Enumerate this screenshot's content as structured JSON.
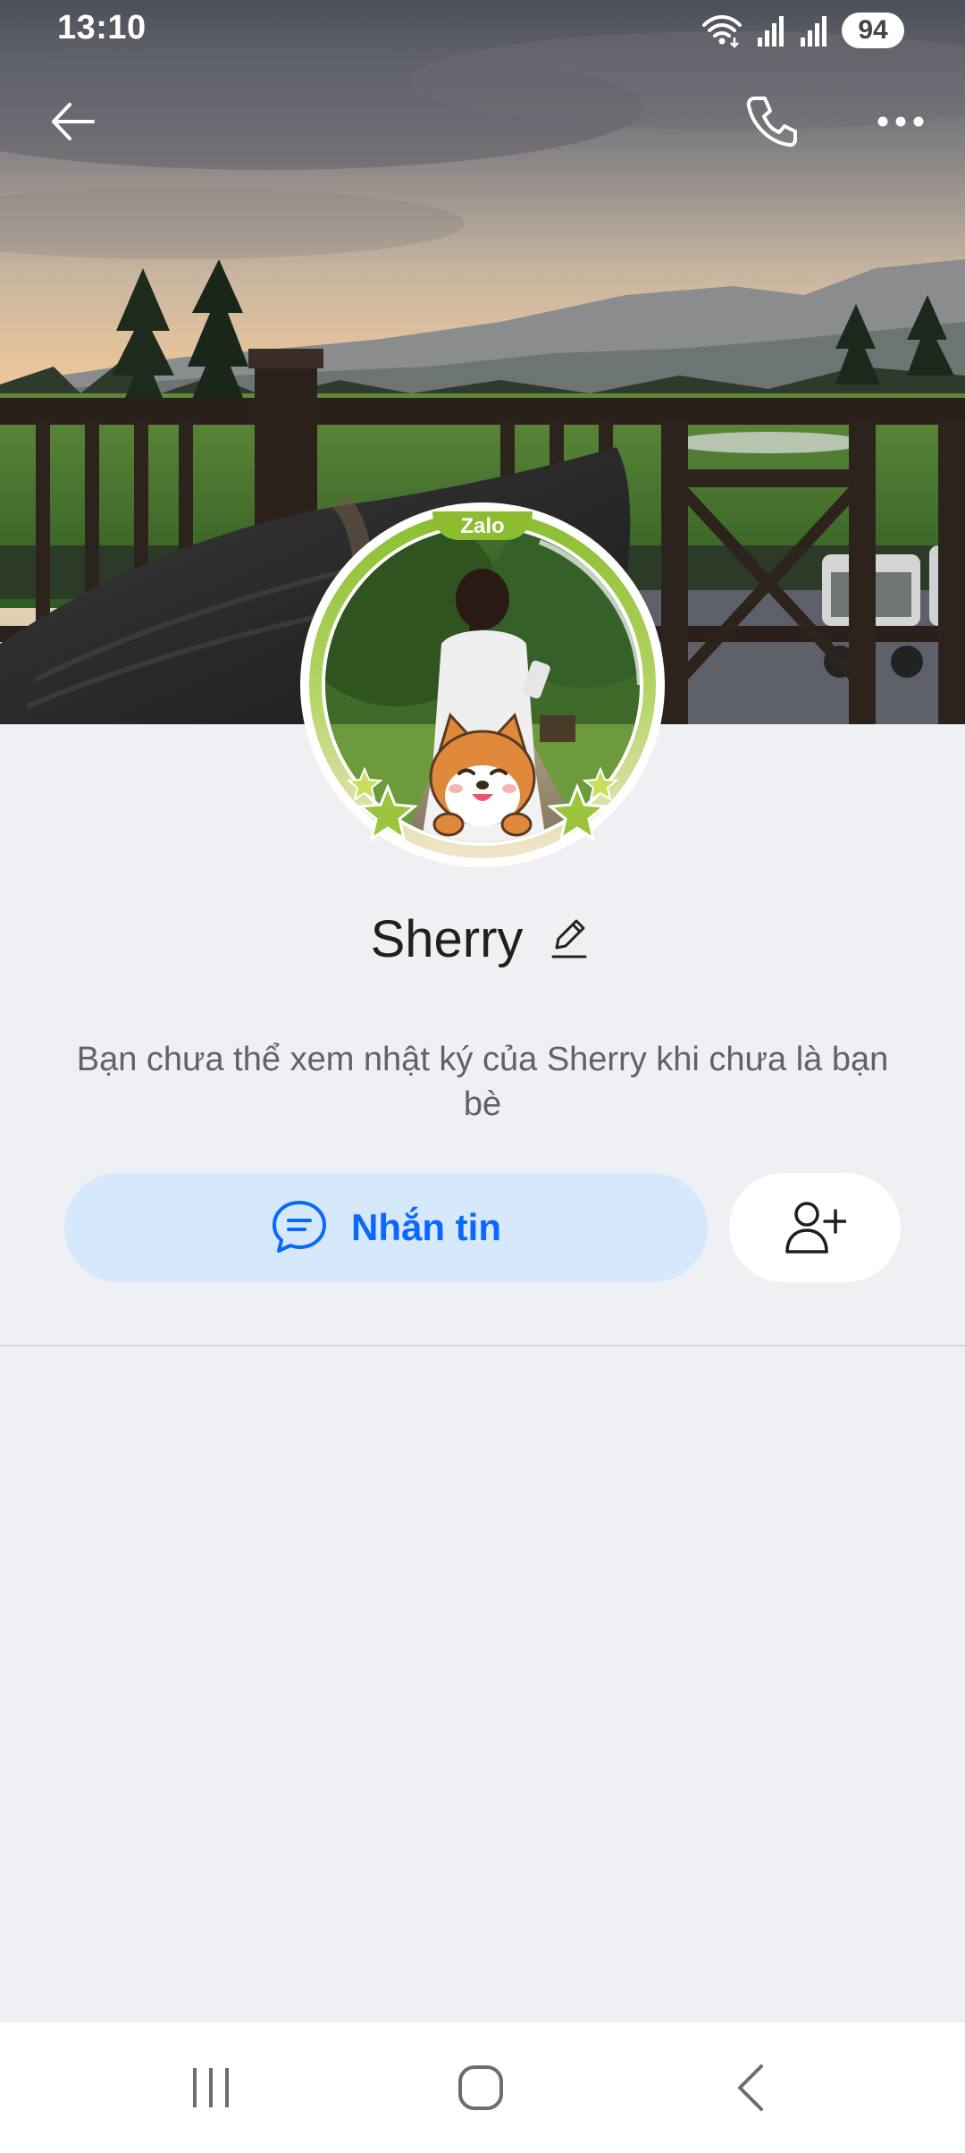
{
  "status_bar": {
    "time": "13:10",
    "battery": "94"
  },
  "header": {
    "back_icon": "arrow-left-icon",
    "call_icon": "phone-icon",
    "more_icon": "more-horizontal-icon"
  },
  "avatar": {
    "frame_label": "Zalo",
    "frame_color": "#9bc53d",
    "sticker": "shiba-dog-sticker"
  },
  "profile": {
    "name": "Sherry",
    "edit_icon": "pencil-icon",
    "privacy_note": "Bạn chưa thể xem nhật ký của Sherry khi chưa là bạn bè"
  },
  "actions": {
    "message_label": "Nhắn tin",
    "message_icon": "chat-bubble-icon",
    "add_friend_icon": "add-user-icon",
    "accent_color": "#0a68ff"
  },
  "nav": {
    "recent_icon": "recent-apps-icon",
    "home_icon": "home-icon",
    "back_icon": "back-chevron-icon"
  }
}
